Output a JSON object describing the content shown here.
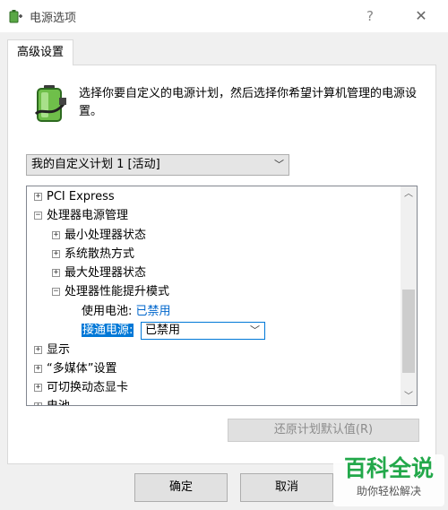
{
  "window": {
    "title": "电源选项",
    "help_symbol": "?",
    "close_symbol": "✕"
  },
  "tab": {
    "label": "高级设置"
  },
  "intro": {
    "text": "选择你要自定义的电源计划，然后选择你希望计算机管理的电源设置。"
  },
  "plan_select": {
    "value": "我的自定义计划 1 [活动]"
  },
  "tree": {
    "items": [
      {
        "expander": "⊞",
        "label": "PCI Express"
      },
      {
        "expander": "⊟",
        "label": "处理器电源管理"
      },
      {
        "expander": "⊞",
        "label": "最小处理器状态"
      },
      {
        "expander": "⊞",
        "label": "系统散热方式"
      },
      {
        "expander": "⊞",
        "label": "最大处理器状态"
      },
      {
        "expander": "⊟",
        "label": "处理器性能提升模式"
      },
      {
        "label": "使用电池:",
        "value": "已禁用"
      },
      {
        "label": "接通电源:",
        "value": "已禁用"
      },
      {
        "expander": "⊞",
        "label": "显示"
      },
      {
        "expander": "⊞",
        "label": "“多媒体”设置"
      },
      {
        "expander": "⊞",
        "label": "可切换动态显卡"
      },
      {
        "expander": "⊞",
        "label": "电池"
      }
    ]
  },
  "restore_button": {
    "label": "还原计划默认值(R)"
  },
  "buttons": {
    "ok": "确定",
    "cancel": "取消"
  },
  "watermark": {
    "top": "百科全说",
    "bottom": "助你轻松解决"
  },
  "colors": {
    "accent": "#0078d7",
    "link": "#0066cc",
    "watermark_green": "#22a84a"
  },
  "icons": {
    "app": "power-options-icon",
    "battery": "battery-plug-icon"
  }
}
